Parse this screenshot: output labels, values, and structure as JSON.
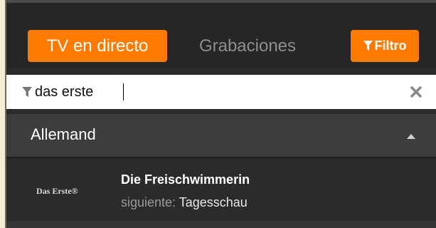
{
  "header": {
    "tabs": [
      {
        "label": "TV en directo",
        "active": true
      },
      {
        "label": "Grabaciones",
        "active": false
      }
    ],
    "filter_button": {
      "label": "Filtro",
      "icon": "funnel-icon"
    }
  },
  "search": {
    "value": "das erste",
    "icon": "funnel-icon",
    "clear_icon": "close-icon"
  },
  "group": {
    "title": "Allemand",
    "expanded": true,
    "icon": "caret-up-icon"
  },
  "channels": [
    {
      "logo_text": "Das Erste®",
      "current_program": "Die Freischwimmerin",
      "next_label": "siguiente:",
      "next_program": "Tagesschau"
    }
  ],
  "colors": {
    "accent": "#ff7a00",
    "background": "#2b2b2b",
    "header_background": "#262626",
    "group_background": "#3d3d3d",
    "search_background": "#ffffff"
  }
}
